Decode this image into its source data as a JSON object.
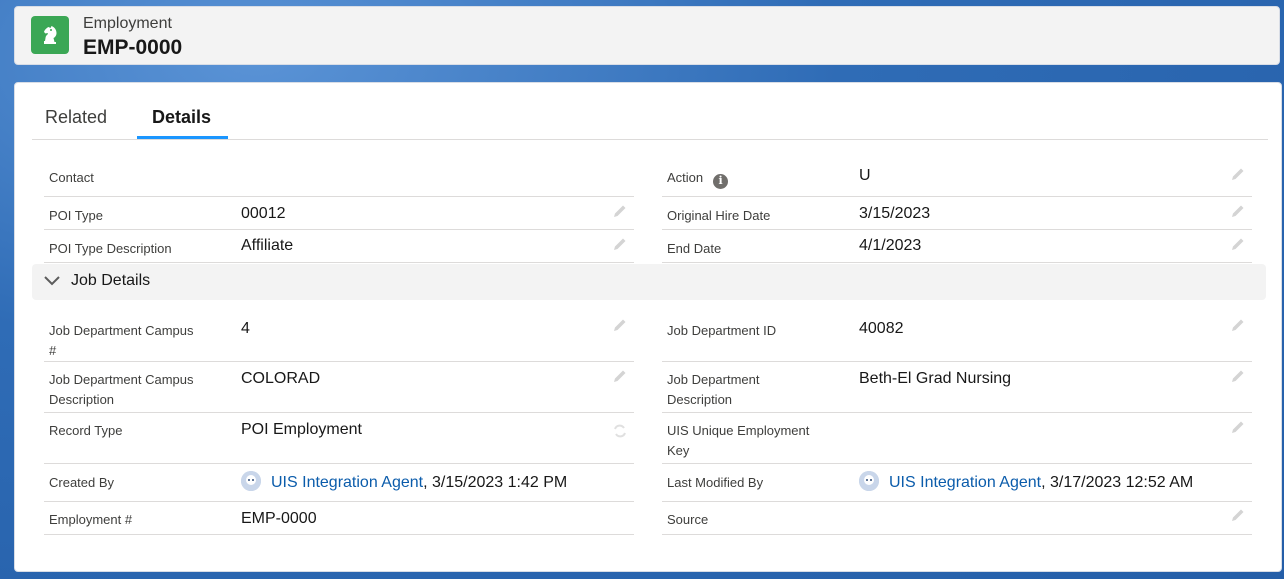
{
  "header": {
    "kicker": "Employment",
    "title": "EMP-0000"
  },
  "tabs": [
    {
      "label": "Related",
      "active": false
    },
    {
      "label": "Details",
      "active": true
    }
  ],
  "top_fields": {
    "contact": {
      "label": "Contact",
      "value": ""
    },
    "action": {
      "label": "Action",
      "value": "U"
    },
    "poi_type": {
      "label": "POI Type",
      "value": "00012"
    },
    "original_hire_date": {
      "label": "Original Hire Date",
      "value": "3/15/2023"
    },
    "poi_type_description": {
      "label": "POI Type Description",
      "value": "Affiliate"
    },
    "end_date": {
      "label": "End Date",
      "value": "4/1/2023"
    }
  },
  "section": {
    "title": "Job Details"
  },
  "job_fields": {
    "campus_num": {
      "label_line1": "Job Department Campus",
      "label_line2": "#",
      "value": "4"
    },
    "dept_id": {
      "label": "Job Department ID",
      "value": "40082"
    },
    "campus_desc": {
      "label_line1": "Job Department Campus",
      "label_line2": "Description",
      "value": "COLORAD"
    },
    "dept_desc": {
      "label_line1": "Job Department",
      "label_line2": "Description",
      "value": "Beth-El Grad Nursing"
    },
    "record_type": {
      "label": "Record Type",
      "value": "POI Employment"
    },
    "unique_key": {
      "label_line1": "UIS Unique Employment",
      "label_line2": "Key",
      "value": ""
    },
    "created_by": {
      "label": "Created By",
      "user": "UIS Integration Agent",
      "timestamp": ", 3/15/2023 1:42 PM"
    },
    "last_modified_by": {
      "label": "Last Modified By",
      "user": "UIS Integration Agent",
      "timestamp": ", 3/17/2023 12:52 AM"
    },
    "employment_num": {
      "label": "Employment #",
      "value": "EMP-0000"
    },
    "source": {
      "label": "Source",
      "value": ""
    }
  },
  "colors": {
    "brand_green": "#3ba755",
    "link_blue": "#0b5cab",
    "tab_active": "#1b96ff"
  }
}
